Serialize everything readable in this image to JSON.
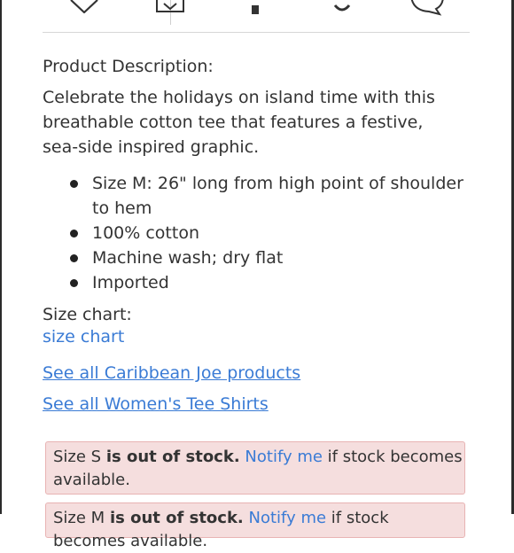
{
  "share_bar": {
    "icons": [
      "heart-icon",
      "like-box-icon",
      "facebook-icon",
      "pinterest-icon",
      "comment-icon"
    ]
  },
  "description": {
    "heading": "Product Description:",
    "body": "Celebrate the holidays on island time with this breathable cotton tee that features a festive, sea-side inspired graphic.",
    "bullets": [
      "Size M: 26\" long from high point of shoulder to hem",
      "100% cotton",
      "Machine wash; dry flat",
      "Imported"
    ]
  },
  "size_chart": {
    "label": "Size chart:",
    "link": "size chart"
  },
  "links": {
    "brand": "See all Caribbean Joe products",
    "category": "See all Women's Tee Shirts"
  },
  "stock_alerts": [
    {
      "prefix": "Size S ",
      "status": "is out of stock.",
      "notify": "Notify me",
      "suffix": " if stock becomes available."
    },
    {
      "prefix": "Size M ",
      "status": "is out of stock.",
      "notify": "Notify me",
      "suffix": " if stock becomes available."
    }
  ],
  "colors": {
    "link": "#3a7bd5",
    "alert_bg": "#f5dede",
    "alert_border": "#e8b3b3",
    "text": "#333333"
  }
}
